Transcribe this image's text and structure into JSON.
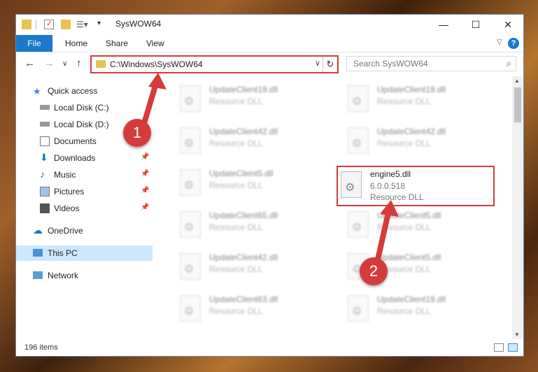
{
  "window": {
    "title": "SysWOW64"
  },
  "ribbon": {
    "file": "File",
    "home": "Home",
    "share": "Share",
    "view": "View"
  },
  "address": {
    "path": "C:\\Windows\\SysWOW64"
  },
  "search": {
    "placeholder": "Search SysWOW64"
  },
  "sidebar": {
    "items": [
      {
        "label": "Quick access"
      },
      {
        "label": "Local Disk (C:)"
      },
      {
        "label": "Local Disk (D:)"
      },
      {
        "label": "Documents"
      },
      {
        "label": "Downloads"
      },
      {
        "label": "Music"
      },
      {
        "label": "Pictures"
      },
      {
        "label": "Videos"
      },
      {
        "label": "OneDrive"
      },
      {
        "label": "This PC"
      },
      {
        "label": "Network"
      }
    ]
  },
  "files": {
    "left": [
      {
        "name": "UpdateClient19.dll",
        "type": "Resource DLL"
      },
      {
        "name": "UpdateClient42.dll",
        "type": "Resource DLL"
      },
      {
        "name": "UpdateClient5.dll",
        "type": "Resource DLL"
      },
      {
        "name": "UpdateClient65.dll",
        "type": "Resource DLL"
      },
      {
        "name": "UpdateClient42.dll",
        "type": "Resource DLL"
      },
      {
        "name": "UpdateClient63.dll",
        "type": "Resource DLL"
      }
    ],
    "right": [
      {
        "name": "UpdateClient19.dll",
        "type": "Resource DLL"
      },
      {
        "name": "UpdateClient42.dll",
        "type": "Resource DLL"
      },
      {
        "name": "UpdateClient5.dll",
        "type": "Resource DLL"
      },
      {
        "name": "UpdateClient5.dll",
        "type": "Resource DLL"
      },
      {
        "name": "UpdateClient19.dll",
        "type": "Resource DLL"
      }
    ],
    "highlighted": {
      "name": "engine5.dll",
      "version": "6.0.0.518",
      "type": "Resource DLL"
    }
  },
  "status": {
    "count": "196 items"
  },
  "annotations": {
    "one": "1",
    "two": "2"
  },
  "colors": {
    "accent": "#1979ca",
    "annotation_red": "#d63b3b",
    "selection": "#cce8ff"
  }
}
